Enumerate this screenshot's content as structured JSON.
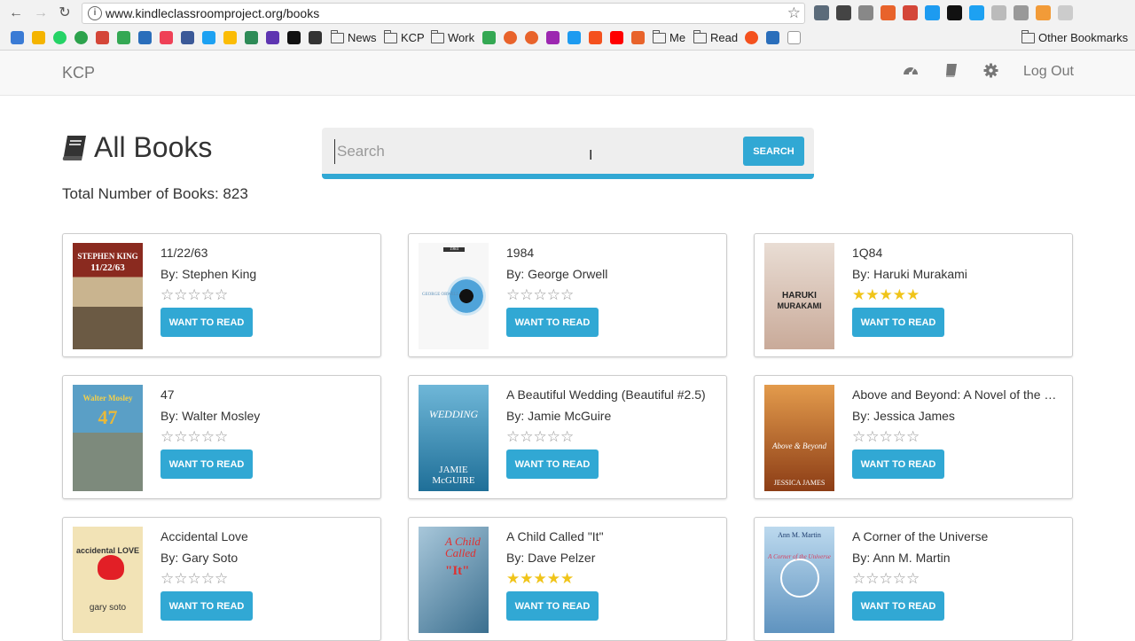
{
  "browser": {
    "url": "www.kindleclassroomproject.org/books",
    "bookmarks": [
      {
        "label": "News"
      },
      {
        "label": "KCP"
      },
      {
        "label": "Work"
      },
      {
        "label": "Me"
      },
      {
        "label": "Read"
      },
      {
        "label": "Other Bookmarks"
      }
    ]
  },
  "app": {
    "brand": "KCP",
    "logout": "Log Out"
  },
  "page": {
    "title": "All Books",
    "total_label": "Total Number of Books: 823"
  },
  "search": {
    "placeholder": "Search",
    "button": "SEARCH"
  },
  "books": [
    {
      "title": "11/22/63",
      "author": "By: Stephen King",
      "rating_stars": "☆☆☆☆☆",
      "rated": false,
      "button": "WANT TO READ",
      "cover_color": "#6b5a44"
    },
    {
      "title": "1984",
      "author": "By: George Orwell",
      "rating_stars": "☆☆☆☆☆",
      "rated": false,
      "button": "WANT TO READ",
      "cover_color": "#f4f4f4"
    },
    {
      "title": "1Q84",
      "author": "By: Haruki Murakami",
      "rating_stars": "★★★★★",
      "rated": true,
      "button": "WANT TO READ",
      "cover_color": "#d9c3b6"
    },
    {
      "title": "47",
      "author": "By: Walter Mosley",
      "rating_stars": "☆☆☆☆☆",
      "rated": false,
      "button": "WANT TO READ",
      "cover_color": "#7a8f9c"
    },
    {
      "title": "A Beautiful Wedding (Beautiful #2.5)",
      "author": "By: Jamie McGuire",
      "rating_stars": "☆☆☆☆☆",
      "rated": false,
      "button": "WANT TO READ",
      "cover_color": "#3f8fb3"
    },
    {
      "title": "Above and Beyond: A Novel of the Civi...",
      "author": "By: Jessica James",
      "rating_stars": "☆☆☆☆☆",
      "rated": false,
      "button": "WANT TO READ",
      "cover_color": "#b86a2c"
    },
    {
      "title": "Accidental Love",
      "author": "By: Gary Soto",
      "rating_stars": "☆☆☆☆☆",
      "rated": false,
      "button": "WANT TO READ",
      "cover_color": "#f2e3b6"
    },
    {
      "title": "A Child Called \"It\"",
      "author": "By: Dave Pelzer",
      "rating_stars": "★★★★★",
      "rated": true,
      "button": "WANT TO READ",
      "cover_color": "#5d8fb0"
    },
    {
      "title": "A Corner of the Universe",
      "author": "By: Ann M. Martin",
      "rating_stars": "☆☆☆☆☆",
      "rated": false,
      "button": "WANT TO READ",
      "cover_color": "#7fb0d6"
    }
  ],
  "covers": [
    {
      "line1": "STEPHEN KING",
      "line2": "11/22/63"
    },
    {
      "line1": "GEORGE ORWELL",
      "line2": "1984"
    },
    {
      "line1": "HARUKI",
      "line2": "MURAKAMI"
    },
    {
      "line1": "Walter Mosley",
      "line2": "47"
    },
    {
      "line1": "WEDDING",
      "line2": "JAMIE McGUIRE"
    },
    {
      "line1": "Above & Beyond",
      "line2": "JESSICA JAMES"
    },
    {
      "line1": "accidental LOVE",
      "line2": "gary soto"
    },
    {
      "line1": "A Child Called",
      "line2": "\"It\""
    },
    {
      "line1": "Ann M. Martin",
      "line2": "A Corner of the Universe"
    }
  ]
}
